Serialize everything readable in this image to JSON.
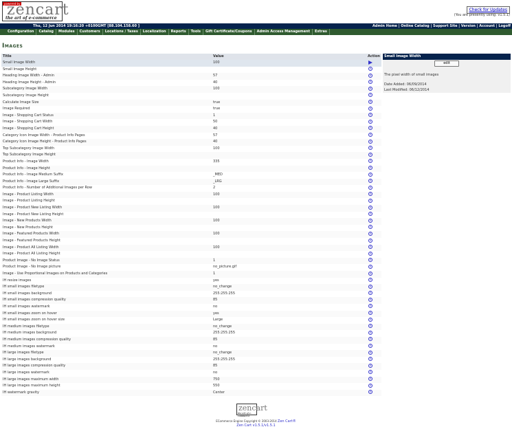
{
  "header": {
    "logo": {
      "powered": "powered by",
      "word": "zencart",
      "tagline": "the art of e-commerce"
    },
    "check_updates_label": "Check for Updates",
    "version_note": "(You are presently using: v1.5.1)"
  },
  "topbar": {
    "datetime": "Thu, 12 Jun 2014 19:16:20 +0100GMT [88.104.158.60 ]",
    "links": [
      "Admin Home",
      "Online Catalog",
      "Support Site",
      "Version",
      "Account",
      "Logoff"
    ]
  },
  "nav": {
    "items": [
      "Configuration",
      "Catalog",
      "Modules",
      "Customers",
      "Locations / Taxes",
      "Localization",
      "Reports",
      "Tools",
      "Gift Certificate/Coupons",
      "Admin Access Management",
      "Extras"
    ]
  },
  "page": {
    "title": "Images"
  },
  "table": {
    "columns": {
      "title": "Title",
      "value": "Value",
      "action": "Action"
    },
    "rows": [
      {
        "title": "Small Image Width",
        "value": "100",
        "selected": true
      },
      {
        "title": "Small Image Height",
        "value": ""
      },
      {
        "title": "Heading Image Width - Admin",
        "value": "57"
      },
      {
        "title": "Heading Image Height - Admin",
        "value": "40"
      },
      {
        "title": "Subcategory Image Width",
        "value": "100"
      },
      {
        "title": "Subcategory Image Height",
        "value": ""
      },
      {
        "title": "Calculate Image Size",
        "value": "true"
      },
      {
        "title": "Image Required",
        "value": "true"
      },
      {
        "title": "Image - Shopping Cart Status",
        "value": "1"
      },
      {
        "title": "Image - Shopping Cart Width",
        "value": "50"
      },
      {
        "title": "Image - Shopping Cart Height",
        "value": "40"
      },
      {
        "title": "Category Icon Image Width - Product Info Pages",
        "value": "57"
      },
      {
        "title": "Category Icon Image Height - Product Info Pages",
        "value": "40"
      },
      {
        "title": "Top Subcategory Image Width",
        "value": "100"
      },
      {
        "title": "Top Subcategory Image Height",
        "value": ""
      },
      {
        "title": "Product Info - Image Width",
        "value": "335"
      },
      {
        "title": "Product Info - Image Height",
        "value": ""
      },
      {
        "title": "Product Info - Image Medium Suffix",
        "value": "_MED"
      },
      {
        "title": "Product Info - Image Large Suffix",
        "value": "_LRG"
      },
      {
        "title": "Product Info - Number of Additional Images per Row",
        "value": "2"
      },
      {
        "title": "Image - Product Listing Width",
        "value": "100"
      },
      {
        "title": "Image - Product Listing Height",
        "value": ""
      },
      {
        "title": "Image - Product New Listing Width",
        "value": "100"
      },
      {
        "title": "Image - Product New Listing Height",
        "value": ""
      },
      {
        "title": "Image - New Products Width",
        "value": "100"
      },
      {
        "title": "Image - New Products Height",
        "value": ""
      },
      {
        "title": "Image - Featured Products Width",
        "value": "100"
      },
      {
        "title": "Image - Featured Products Height",
        "value": ""
      },
      {
        "title": "Image - Product All Listing Width",
        "value": "100"
      },
      {
        "title": "Image - Product All Listing Height",
        "value": ""
      },
      {
        "title": "Product Image - No Image Status",
        "value": "1"
      },
      {
        "title": "Product Image - No Image picture",
        "value": "no_picture.gif"
      },
      {
        "title": "Image - Use Proportional Images on Products and Categories",
        "value": "1"
      },
      {
        "title": "IH resize images",
        "value": "yes"
      },
      {
        "title": "IH small images filetype",
        "value": "no_change"
      },
      {
        "title": "IH small images background",
        "value": "255:255:255"
      },
      {
        "title": "IH small images compression quality",
        "value": "85"
      },
      {
        "title": "IH small images watermark",
        "value": "no"
      },
      {
        "title": "IH small images zoom on hover",
        "value": "yes"
      },
      {
        "title": "IH small images zoom on hover size",
        "value": "Large"
      },
      {
        "title": "IH medium images filetype",
        "value": "no_change"
      },
      {
        "title": "IH medium images background",
        "value": "255:255:255"
      },
      {
        "title": "IH medium images compression quality",
        "value": "85"
      },
      {
        "title": "IH medium images watermark",
        "value": "no"
      },
      {
        "title": "IH large images filetype",
        "value": "no_change"
      },
      {
        "title": "IH large images background",
        "value": "255:255:255"
      },
      {
        "title": "IH large images compression quality",
        "value": "85"
      },
      {
        "title": "IH large images watermark",
        "value": "no"
      },
      {
        "title": "IH large images maximum width",
        "value": "750"
      },
      {
        "title": "IH large images maximum height",
        "value": "550"
      },
      {
        "title": "IH watermark gravity",
        "value": "Center"
      }
    ]
  },
  "side_panel": {
    "title": "Small Image Width",
    "edit_label": "edit",
    "description": "The pixel width of small images",
    "date_added": "Date Added: 06/09/2014",
    "last_modified": "Last Modified: 06/12/2014"
  },
  "footer": {
    "logo": {
      "word": "zencart",
      "tagline": "the art of e-commerce"
    },
    "copyright": "ECommerce Engine Copyright © 2003-2014",
    "copyright_link": "Zen Cart®",
    "version": "Zen Cart v1.5.1/v1.5.1"
  },
  "colors": {
    "topbar_bg": "#06234d",
    "nav_bg": "#2f5a2f",
    "title_color": "#2f4f2f",
    "link_color": "#3333cc",
    "selected_row": "#dfe6ee"
  }
}
